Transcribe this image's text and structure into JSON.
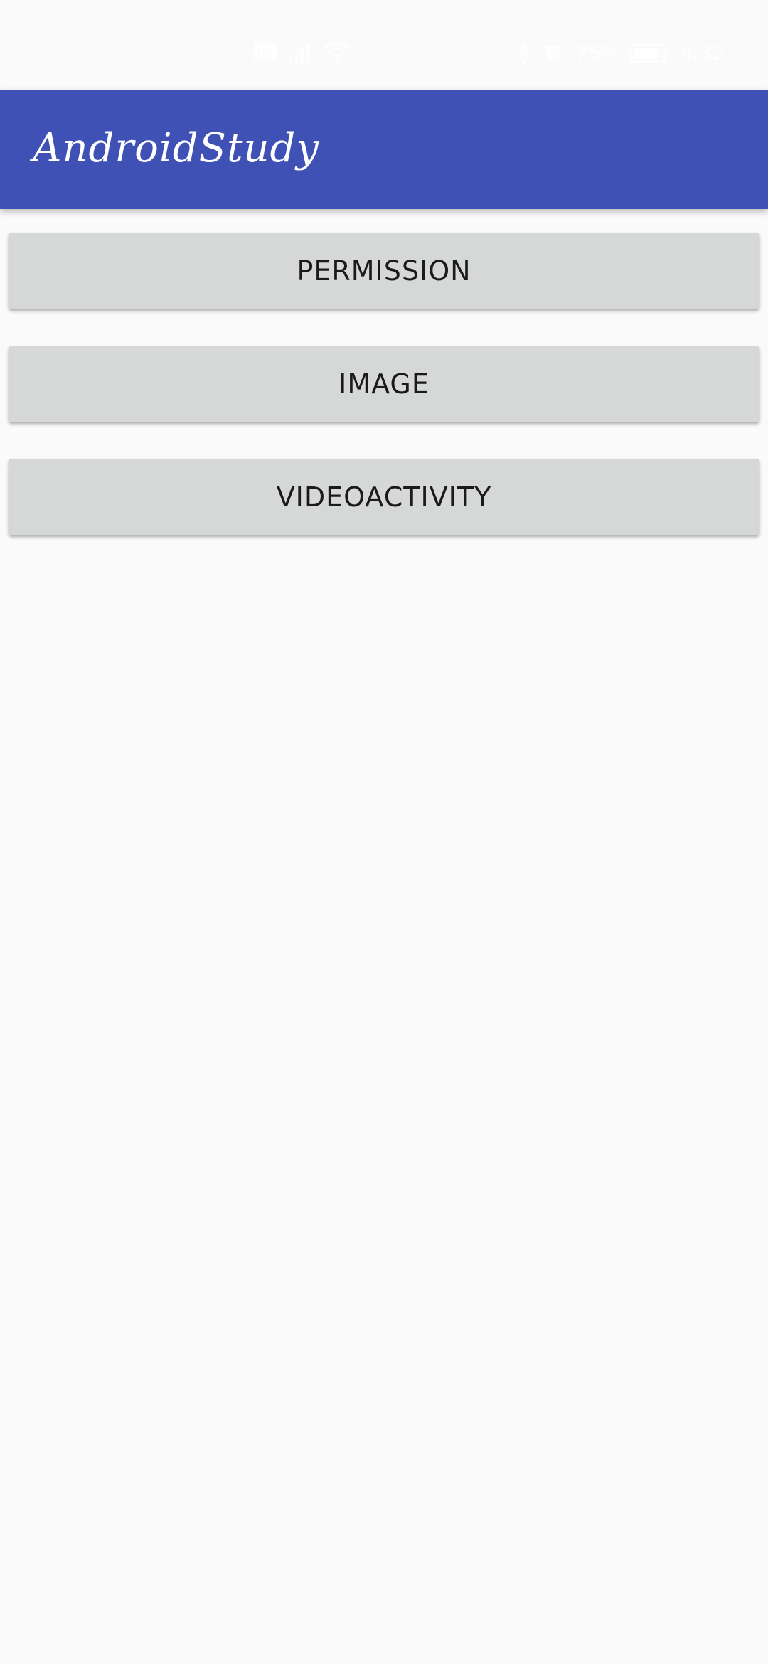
{
  "status_bar": {
    "left_icons": [
      "hd-icon",
      "signal-icon",
      "wifi-icon"
    ],
    "right_icons": [
      "bluetooth-icon",
      "mute-icon",
      "battery-icon"
    ],
    "battery_percent": "75%",
    "time": "4:32"
  },
  "app_bar": {
    "title": "AndroidStudy",
    "background_color": "#3f51b5"
  },
  "buttons": [
    {
      "label": "PERMISSION"
    },
    {
      "label": "IMAGE"
    },
    {
      "label": "VIDEOACTIVITY"
    }
  ]
}
